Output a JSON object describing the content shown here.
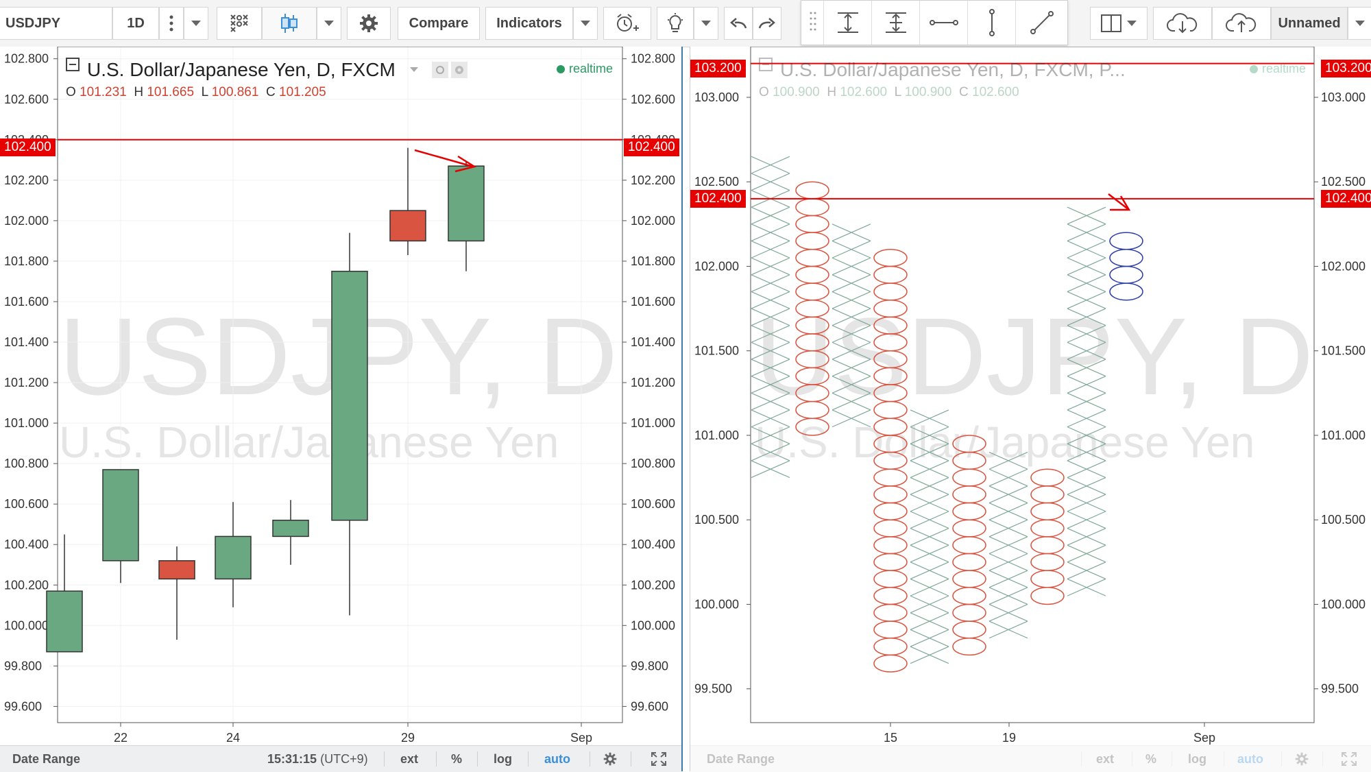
{
  "toolbar": {
    "symbol": "USDJPY",
    "interval": "1D",
    "compare_label": "Compare",
    "indicators_label": "Indicators",
    "layout_name": "Unnamed"
  },
  "left_chart": {
    "title": "U.S. Dollar/Japanese Yen, D, FXCM",
    "status": "realtime",
    "ohlc": {
      "o_label": "O",
      "o": "101.231",
      "h_label": "H",
      "h": "101.665",
      "l_label": "L",
      "l": "100.861",
      "c_label": "C",
      "c": "101.205"
    },
    "watermark_symbol": "USDJPY, D",
    "watermark_name": "U.S. Dollar/Japanese Yen",
    "price_line": "102.400",
    "y_ticks": [
      "102.800",
      "102.600",
      "102.400",
      "102.200",
      "102.000",
      "101.800",
      "101.600",
      "101.400",
      "101.200",
      "101.000",
      "100.800",
      "100.600",
      "100.400",
      "100.200",
      "100.000",
      "99.800",
      "99.600"
    ],
    "x_ticks": [
      "22",
      "24",
      "29",
      "Sep"
    ],
    "bottom": {
      "date_range": "Date Range",
      "time": "15:31:15",
      "tz": "(UTC+9)",
      "ext": "ext",
      "pct": "%",
      "log": "log",
      "auto": "auto"
    }
  },
  "right_chart": {
    "title": "U.S. Dollar/Japanese Yen, D, FXCM, P...",
    "status": "realtime",
    "ohlc": {
      "o_label": "O",
      "o": "100.900",
      "h_label": "H",
      "h": "102.600",
      "l_label": "L",
      "l": "100.900",
      "c_label": "C",
      "c": "102.600"
    },
    "watermark_symbol": "USDJPY, D",
    "watermark_name": "U.S. Dollar/Japanese Yen",
    "price_line": "102.400",
    "top_tag": "103.200",
    "y_ticks": [
      "103.000",
      "102.500",
      "102.000",
      "101.500",
      "101.000",
      "100.500",
      "100.000",
      "99.500"
    ],
    "x_ticks": [
      "15",
      "19",
      "Sep"
    ],
    "bottom": {
      "date_range": "Date Range",
      "ext": "ext",
      "pct": "%",
      "log": "log",
      "auto": "auto"
    }
  },
  "chart_data": [
    {
      "type": "candlestick",
      "title": "U.S. Dollar/Japanese Yen, D, FXCM",
      "ylim": [
        99.52,
        102.86
      ],
      "x": [
        "21",
        "22",
        "23",
        "24",
        "25",
        "28",
        "29",
        "30"
      ],
      "ohlc": [
        [
          99.87,
          100.45,
          99.87,
          100.17
        ],
        [
          100.32,
          100.77,
          100.21,
          100.77
        ],
        [
          100.32,
          100.39,
          99.93,
          100.23
        ],
        [
          100.23,
          100.61,
          100.09,
          100.44
        ],
        [
          100.44,
          100.62,
          100.3,
          100.52
        ],
        [
          100.52,
          101.94,
          100.05,
          101.75
        ],
        [
          102.05,
          102.36,
          101.83,
          101.9
        ],
        [
          101.9,
          102.29,
          101.75,
          102.27
        ]
      ],
      "colors": {
        "up": "#6aa882",
        "down": "#d95541"
      }
    },
    {
      "type": "point-and-figure",
      "title": "U.S. Dollar/Japanese Yen, D, FXCM, P...",
      "ylim": [
        99.3,
        103.3
      ],
      "columns": [
        {
          "kind": "X",
          "low": 100.75,
          "high": 102.65
        },
        {
          "kind": "O",
          "low": 101.0,
          "high": 102.5
        },
        {
          "kind": "X",
          "low": 101.1,
          "high": 102.25
        },
        {
          "kind": "O",
          "low": 99.6,
          "high": 102.1
        },
        {
          "kind": "X",
          "low": 99.7,
          "high": 101.15
        },
        {
          "kind": "O",
          "low": 99.75,
          "high": 101.0
        },
        {
          "kind": "X",
          "low": 99.8,
          "high": 100.9
        },
        {
          "kind": "O",
          "low": 100.0,
          "high": 100.8
        },
        {
          "kind": "X",
          "low": 100.05,
          "high": 102.35
        },
        {
          "kind": "O",
          "low": 101.8,
          "high": 102.2
        }
      ],
      "colors": {
        "x": "#7fa896",
        "o": "#d95541",
        "current": "#2d3ea8"
      }
    }
  ]
}
